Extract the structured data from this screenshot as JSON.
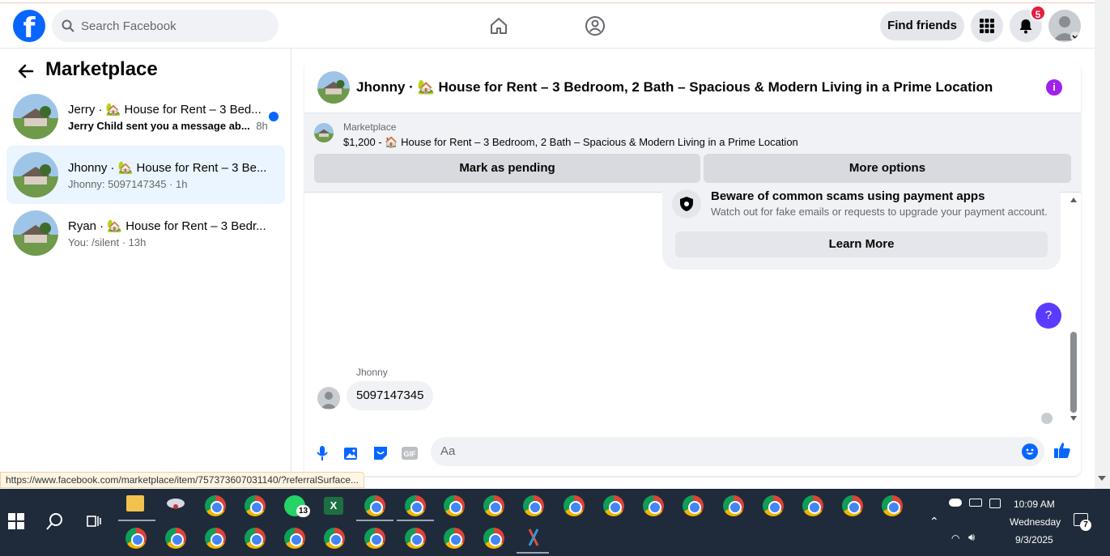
{
  "header": {
    "search_placeholder": "Search Facebook",
    "find_friends": "Find friends",
    "notification_count": "5"
  },
  "sidebar": {
    "title": "Marketplace",
    "conversations": [
      {
        "title": "Jerry · 🏡 House for Rent – 3 Bed...",
        "preview": "Jerry Child sent you a message ab...",
        "time": "8h",
        "unread": true
      },
      {
        "title": "Jhonny · 🏡 House for Rent – 3 Be...",
        "preview": "Jhonny: 5097147345 · 1h",
        "time": "",
        "unread": false
      },
      {
        "title": "Ryan · 🏡 House for Rent – 3 Bedr...",
        "preview": "You: /silent · 13h",
        "time": "",
        "unread": false
      }
    ]
  },
  "chat": {
    "title": "Jhonny · 🏡 House for Rent – 3 Bedroom, 2 Bath – Spacious & Modern Living in a Prime Location",
    "listing_source": "Marketplace",
    "listing_line": "$1,200 - 🏠 House for Rent – 3 Bedroom, 2 Bath – Spacious & Modern Living in a Prime Location",
    "mark_pending": "Mark as pending",
    "more_options": "More options",
    "scam_title": "Beware of common scams using payment apps",
    "scam_desc": "Watch out for fake emails or requests to upgrade your payment account.",
    "learn_more": "Learn More",
    "help": "?",
    "message_sender": "Jhonny",
    "message_text": "5097147345",
    "composer_placeholder": "Aa"
  },
  "status_url": "https://www.facebook.com/marketplace/item/757373607031140/?referralSurface...",
  "taskbar": {
    "whatsapp_badge": "13",
    "time": "10:09 AM",
    "day": "Wednesday",
    "date": "9/3/2025",
    "notif_count": "7"
  },
  "colors": {
    "brand": "#0866ff",
    "selected": "#ebf5ff",
    "badge": "#e41e3f"
  }
}
